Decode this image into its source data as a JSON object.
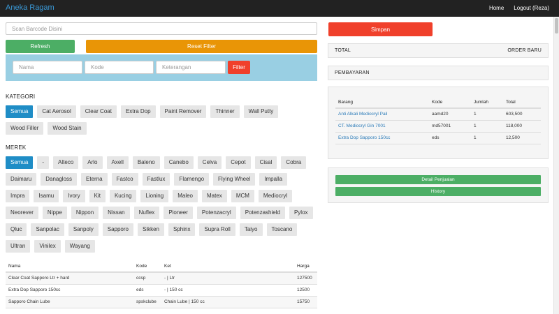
{
  "navbar": {
    "brand": "Aneka Ragam",
    "home": "Home",
    "logout": "Logout (Reza)"
  },
  "barcode": {
    "placeholder": "Scan Barcode Disini"
  },
  "buttons": {
    "refresh": "Refresh",
    "reset_filter": "Reset Filter",
    "filter": "Filter",
    "simpan": "Simpan"
  },
  "filter": {
    "nama_placeholder": "Nama",
    "kode_placeholder": "Kode",
    "keterangan_placeholder": "Keterangan"
  },
  "kategori": {
    "title": "KATEGORI",
    "items": [
      "Semua",
      "Cat Aerosol",
      "Clear Coat",
      "Extra Dop",
      "Paint Remover",
      "Thinner",
      "Wall Putty",
      "Wood Filler",
      "Wood Stain"
    ]
  },
  "merek": {
    "title": "MEREK",
    "items": [
      "Semua",
      "-",
      "Alteco",
      "Arlo",
      "Axell",
      "Baleno",
      "Canebo",
      "Celva",
      "Cepot",
      "Cisal",
      "Cobra",
      "Daimaru",
      "Danagloss",
      "Eterna",
      "Fastco",
      "Fastlux",
      "Flamengo",
      "Flying Wheel",
      "Impalla",
      "Impra",
      "Isamu",
      "Ivory",
      "Kit",
      "Kucing",
      "Lioning",
      "Maleo",
      "Matex",
      "MCM",
      "Mediocryl",
      "Neorever",
      "Nippe",
      "Nippon",
      "Nissan",
      "Nuflex",
      "Pioneer",
      "Potenzacryl",
      "Potenzashield",
      "Pylox",
      "Qluc",
      "Sanpolac",
      "Sanpoly",
      "Sapporo",
      "Sikken",
      "Sphinx",
      "Supra Roll",
      "Taiyo",
      "Toscano",
      "Ultran",
      "Vinilex",
      "Wayang"
    ]
  },
  "products": {
    "headers": [
      "Nama",
      "Kode",
      "Ket",
      "Harga"
    ],
    "rows": [
      [
        "Clear Coat Sapporo Ltr + hard",
        "ccsp",
        "- | Ltr",
        "127500"
      ],
      [
        "Extra Dop Sapporo 150cc",
        "eds",
        "- | 150 cc",
        "12500"
      ],
      [
        "Sapporo Chain Lube",
        "spskclube",
        "Chain Lube | 150 cc",
        "15750"
      ]
    ]
  },
  "summary": {
    "total_label": "TOTAL",
    "order_label": "ORDER BARU",
    "pembayaran_label": "PEMBAYARAN"
  },
  "cart": {
    "headers": [
      "Barang",
      "Kode",
      "Jumlah",
      "Total"
    ],
    "rows": [
      [
        "Anti Alkali Mediocryl Pail",
        "aamd20",
        "1",
        "603,500"
      ],
      [
        "CT. Mediocryl Gin 7001",
        "md57001",
        "1",
        "118,000"
      ],
      [
        "Extra Dop Sapporo 150cc",
        "eds",
        "1",
        "12,500"
      ]
    ]
  },
  "actions": {
    "detail": "Detail Penjualan",
    "history": "History"
  },
  "colors": {
    "primary": "#1f8dc6",
    "green": "#4cae65",
    "orange": "#e99506",
    "red": "#f0402b",
    "panel": "#99cfe3"
  }
}
